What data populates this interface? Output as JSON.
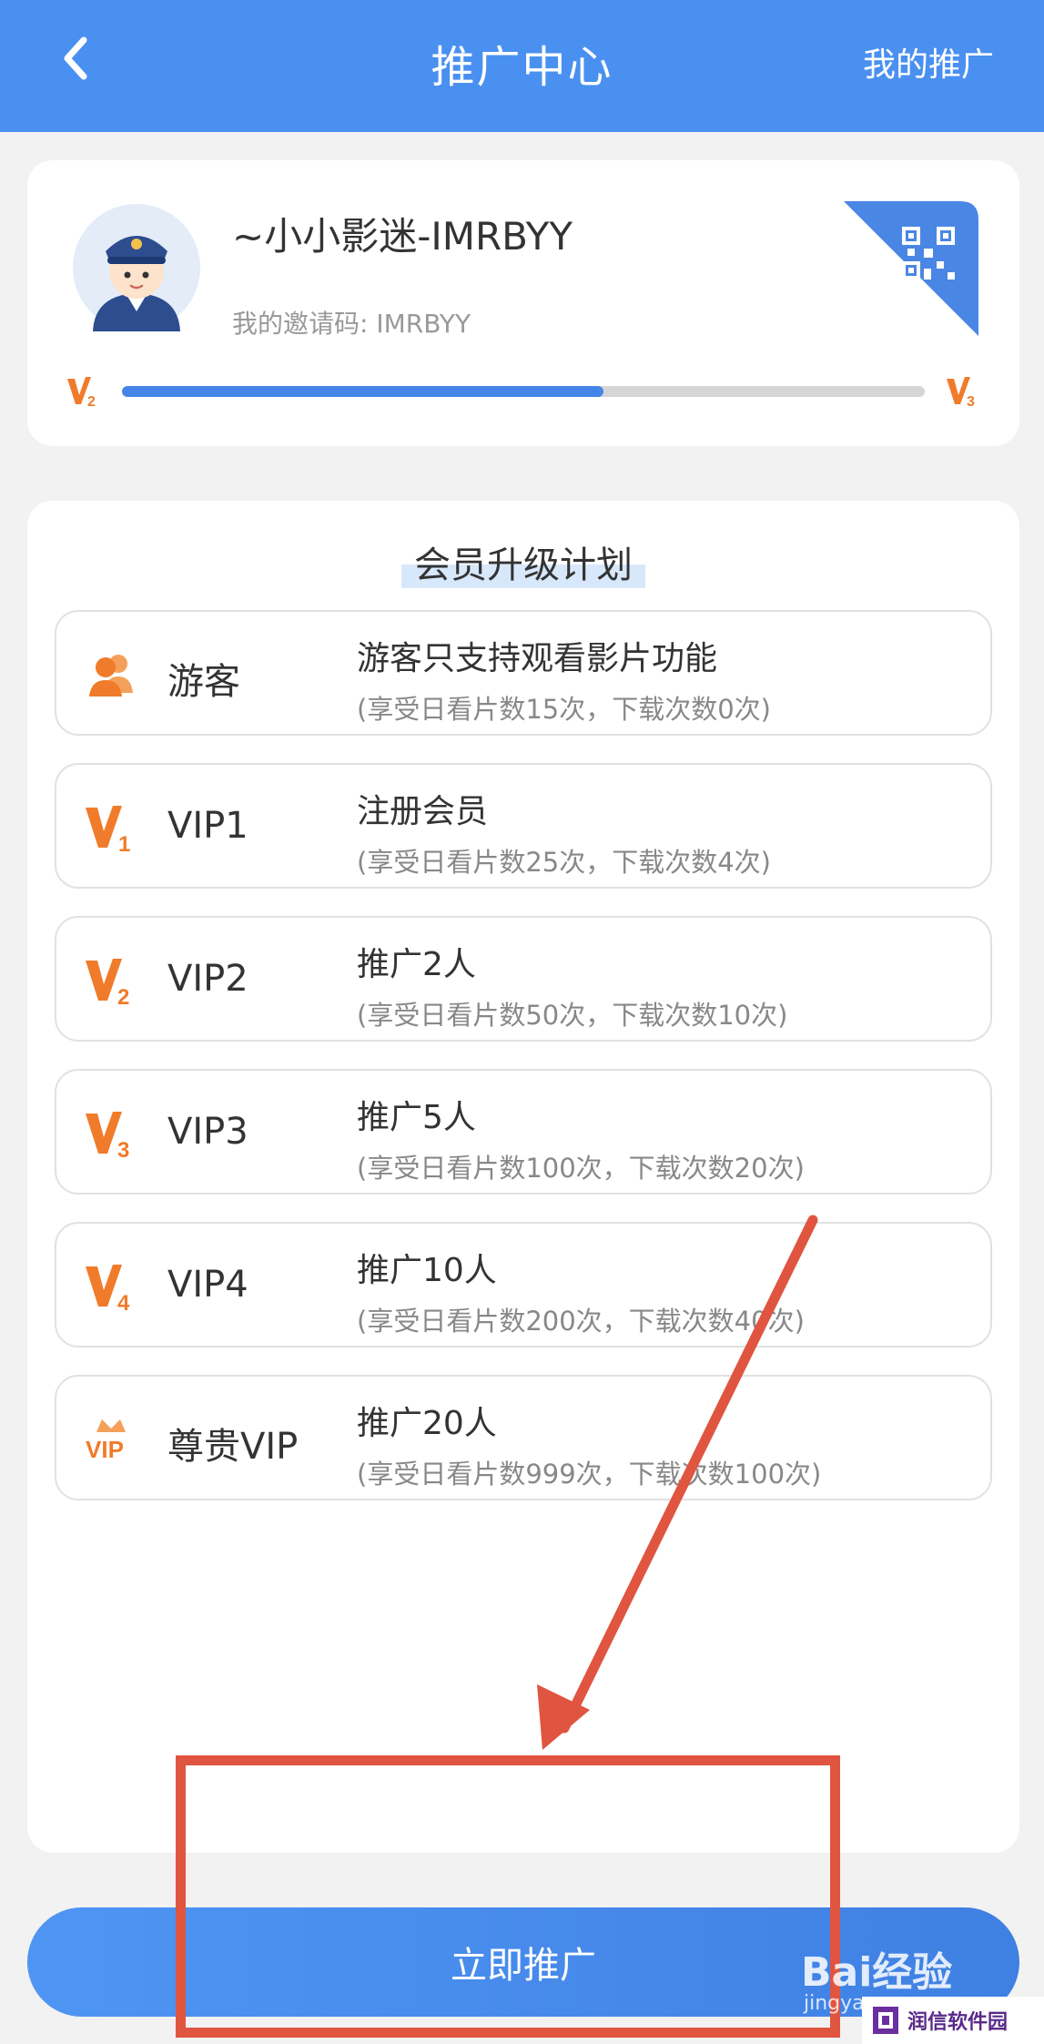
{
  "header": {
    "title": "推广中心",
    "right_link": "我的推广"
  },
  "user": {
    "nickname": "~小小影迷-IMRBYY",
    "invite_label": "我的邀请码: ",
    "invite_code": "IMRBYY",
    "current_level": "V2",
    "next_level": "V3",
    "level_progress": 0.6
  },
  "plan": {
    "title": "会员升级计划",
    "tiers": [
      {
        "icon": "guest-icon",
        "name": "游客",
        "desc": "游客只支持观看影片功能",
        "sub": "(享受日看片数15次，下载次数0次)"
      },
      {
        "icon": "vip1-badge-icon",
        "name": "VIP1",
        "desc": "注册会员",
        "sub": "(享受日看片数25次，下载次数4次)"
      },
      {
        "icon": "vip2-badge-icon",
        "name": "VIP2",
        "desc": "推广2人",
        "sub": "(享受日看片数50次，下载次数10次)"
      },
      {
        "icon": "vip3-badge-icon",
        "name": "VIP3",
        "desc": "推广5人",
        "sub": "(享受日看片数100次，下载次数20次)"
      },
      {
        "icon": "vip4-badge-icon",
        "name": "VIP4",
        "desc": "推广10人",
        "sub": "(享受日看片数200次，下载次数40次)"
      },
      {
        "icon": "crown-vip-icon",
        "name": "尊贵VIP",
        "desc": "推广20人",
        "sub": "(享受日看片数999次，下载次数100次)"
      }
    ]
  },
  "cta": {
    "label": "立即推广"
  },
  "watermarks": {
    "baidu": "Bai经验",
    "baidu_sub": "jingya",
    "brand": "润信软件园"
  },
  "colors": {
    "header": "#4a90f0",
    "accent": "#4585e8",
    "badge_orange": "#f07b2a",
    "annotation_red": "#e05540"
  }
}
